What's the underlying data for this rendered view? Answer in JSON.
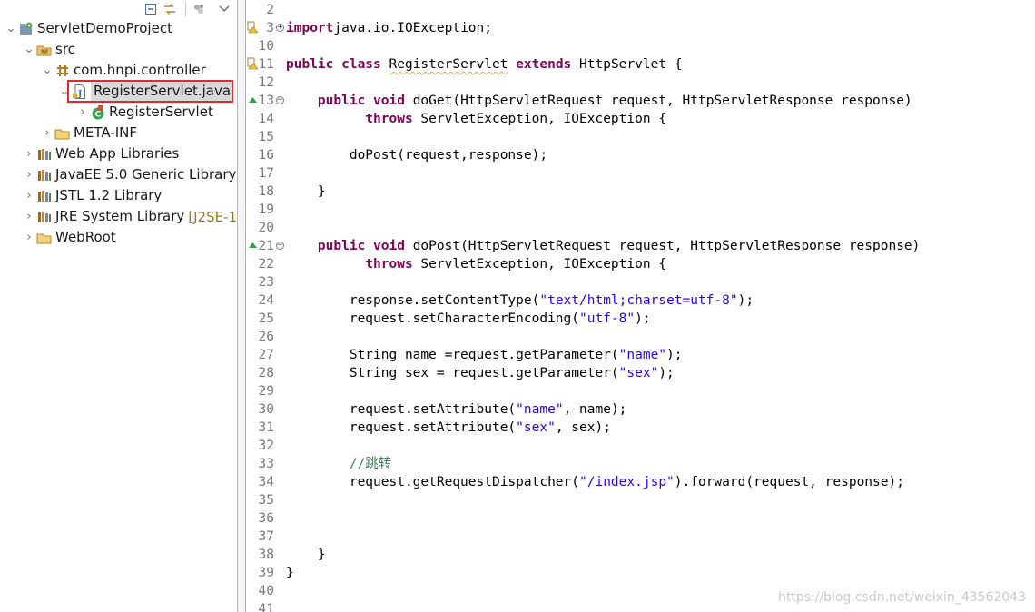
{
  "explorer": {
    "tree": [
      {
        "label": "ServletDemoProject",
        "icon": "project-icon",
        "expanded": true
      },
      {
        "label": "src",
        "icon": "source-folder-icon",
        "expanded": true
      },
      {
        "label": "com.hnpi.controller",
        "icon": "package-icon",
        "expanded": true
      },
      {
        "label": "RegisterServlet.java",
        "icon": "java-file-icon",
        "expanded": true,
        "selected": true
      },
      {
        "label": "RegisterServlet",
        "icon": "class-icon",
        "expanded": false
      },
      {
        "label": "META-INF",
        "icon": "folder-icon",
        "expanded": false
      },
      {
        "label": "Web App Libraries",
        "icon": "library-icon",
        "expanded": false
      },
      {
        "label": "JavaEE 5.0 Generic Library",
        "icon": "library-icon",
        "expanded": false
      },
      {
        "label": "JSTL 1.2 Library",
        "icon": "library-icon",
        "expanded": false
      },
      {
        "label": "JRE System Library",
        "decoration": "[J2SE-1",
        "icon": "library-icon",
        "expanded": false
      },
      {
        "label": "WebRoot",
        "icon": "folder-icon",
        "expanded": false
      }
    ],
    "toolbar": {
      "collapse_all_icon": "collapse-all-icon",
      "link_editor_icon": "link-with-editor-icon",
      "menu_icon": "view-menu-icon"
    }
  },
  "editor": {
    "lines": [
      {
        "n": "2",
        "tokens": []
      },
      {
        "n": "3",
        "marker": "warning",
        "fold": "+",
        "tokens": [
          [
            "kw",
            "import"
          ],
          [
            "",
            "java.io.IOException;"
          ]
        ]
      },
      {
        "n": "10",
        "tokens": []
      },
      {
        "n": "11",
        "marker": "warning",
        "tokens": [
          [
            "kw",
            "public class "
          ],
          [
            "sq",
            "RegisterServlet"
          ],
          [
            "kw",
            " extends "
          ],
          [
            "",
            "HttpServlet {"
          ]
        ]
      },
      {
        "n": "12",
        "tokens": []
      },
      {
        "n": "13",
        "marker": "override",
        "fold": "-",
        "tokens": [
          [
            "",
            "    "
          ],
          [
            "kw",
            "public void "
          ],
          [
            "",
            "doGet(HttpServletRequest request, HttpServletResponse response)"
          ]
        ]
      },
      {
        "n": "14",
        "tokens": [
          [
            "",
            "          "
          ],
          [
            "kw",
            "throws "
          ],
          [
            "",
            "ServletException, IOException {"
          ]
        ]
      },
      {
        "n": "15",
        "tokens": []
      },
      {
        "n": "16",
        "tokens": [
          [
            "",
            "        doPost(request,response);"
          ]
        ]
      },
      {
        "n": "17",
        "tokens": []
      },
      {
        "n": "18",
        "tokens": [
          [
            "",
            "    }"
          ]
        ]
      },
      {
        "n": "19",
        "tokens": []
      },
      {
        "n": "20",
        "tokens": []
      },
      {
        "n": "21",
        "marker": "override",
        "fold": "-",
        "tokens": [
          [
            "",
            "    "
          ],
          [
            "kw",
            "public void "
          ],
          [
            "",
            "doPost(HttpServletRequest request, HttpServletResponse response)"
          ]
        ]
      },
      {
        "n": "22",
        "tokens": [
          [
            "",
            "          "
          ],
          [
            "kw",
            "throws "
          ],
          [
            "",
            "ServletException, IOException {"
          ]
        ]
      },
      {
        "n": "23",
        "tokens": []
      },
      {
        "n": "24",
        "tokens": [
          [
            "",
            "        response.setContentType("
          ],
          [
            "str",
            "\"text/html;charset=utf-8\""
          ],
          [
            "",
            ");"
          ]
        ]
      },
      {
        "n": "25",
        "tokens": [
          [
            "",
            "        request.setCharacterEncoding("
          ],
          [
            "str",
            "\"utf-8\""
          ],
          [
            "",
            ");"
          ]
        ]
      },
      {
        "n": "26",
        "tokens": []
      },
      {
        "n": "27",
        "tokens": [
          [
            "",
            "        String name =request.getParameter("
          ],
          [
            "str",
            "\"name\""
          ],
          [
            "",
            ");"
          ]
        ]
      },
      {
        "n": "28",
        "tokens": [
          [
            "",
            "        String sex = request.getParameter("
          ],
          [
            "str",
            "\"sex\""
          ],
          [
            "",
            ");"
          ]
        ]
      },
      {
        "n": "29",
        "tokens": []
      },
      {
        "n": "30",
        "tokens": [
          [
            "",
            "        request.setAttribute("
          ],
          [
            "str",
            "\"name\""
          ],
          [
            "",
            ", name);"
          ]
        ]
      },
      {
        "n": "31",
        "tokens": [
          [
            "",
            "        request.setAttribute("
          ],
          [
            "str",
            "\"sex\""
          ],
          [
            "",
            ", sex);"
          ]
        ]
      },
      {
        "n": "32",
        "tokens": []
      },
      {
        "n": "33",
        "tokens": [
          [
            "",
            "        "
          ],
          [
            "cmt",
            "//跳转"
          ]
        ]
      },
      {
        "n": "34",
        "tokens": [
          [
            "",
            "        request.getRequestDispatcher("
          ],
          [
            "str",
            "\"/index.jsp\""
          ],
          [
            "",
            ").forward(request, response);"
          ]
        ]
      },
      {
        "n": "35",
        "tokens": []
      },
      {
        "n": "36",
        "tokens": []
      },
      {
        "n": "37",
        "tokens": []
      },
      {
        "n": "38",
        "tokens": [
          [
            "",
            "    }"
          ]
        ]
      },
      {
        "n": "39",
        "tokens": [
          [
            "",
            "}"
          ]
        ]
      },
      {
        "n": "40",
        "tokens": []
      },
      {
        "n": "41",
        "tokens": []
      }
    ]
  },
  "watermark": "https://blog.csdn.net/weixin_43562043",
  "colors": {
    "keyword": "#7f0055",
    "string": "#2a00ff",
    "comment": "#3f7f5f",
    "selection_outline": "#e0282e"
  }
}
